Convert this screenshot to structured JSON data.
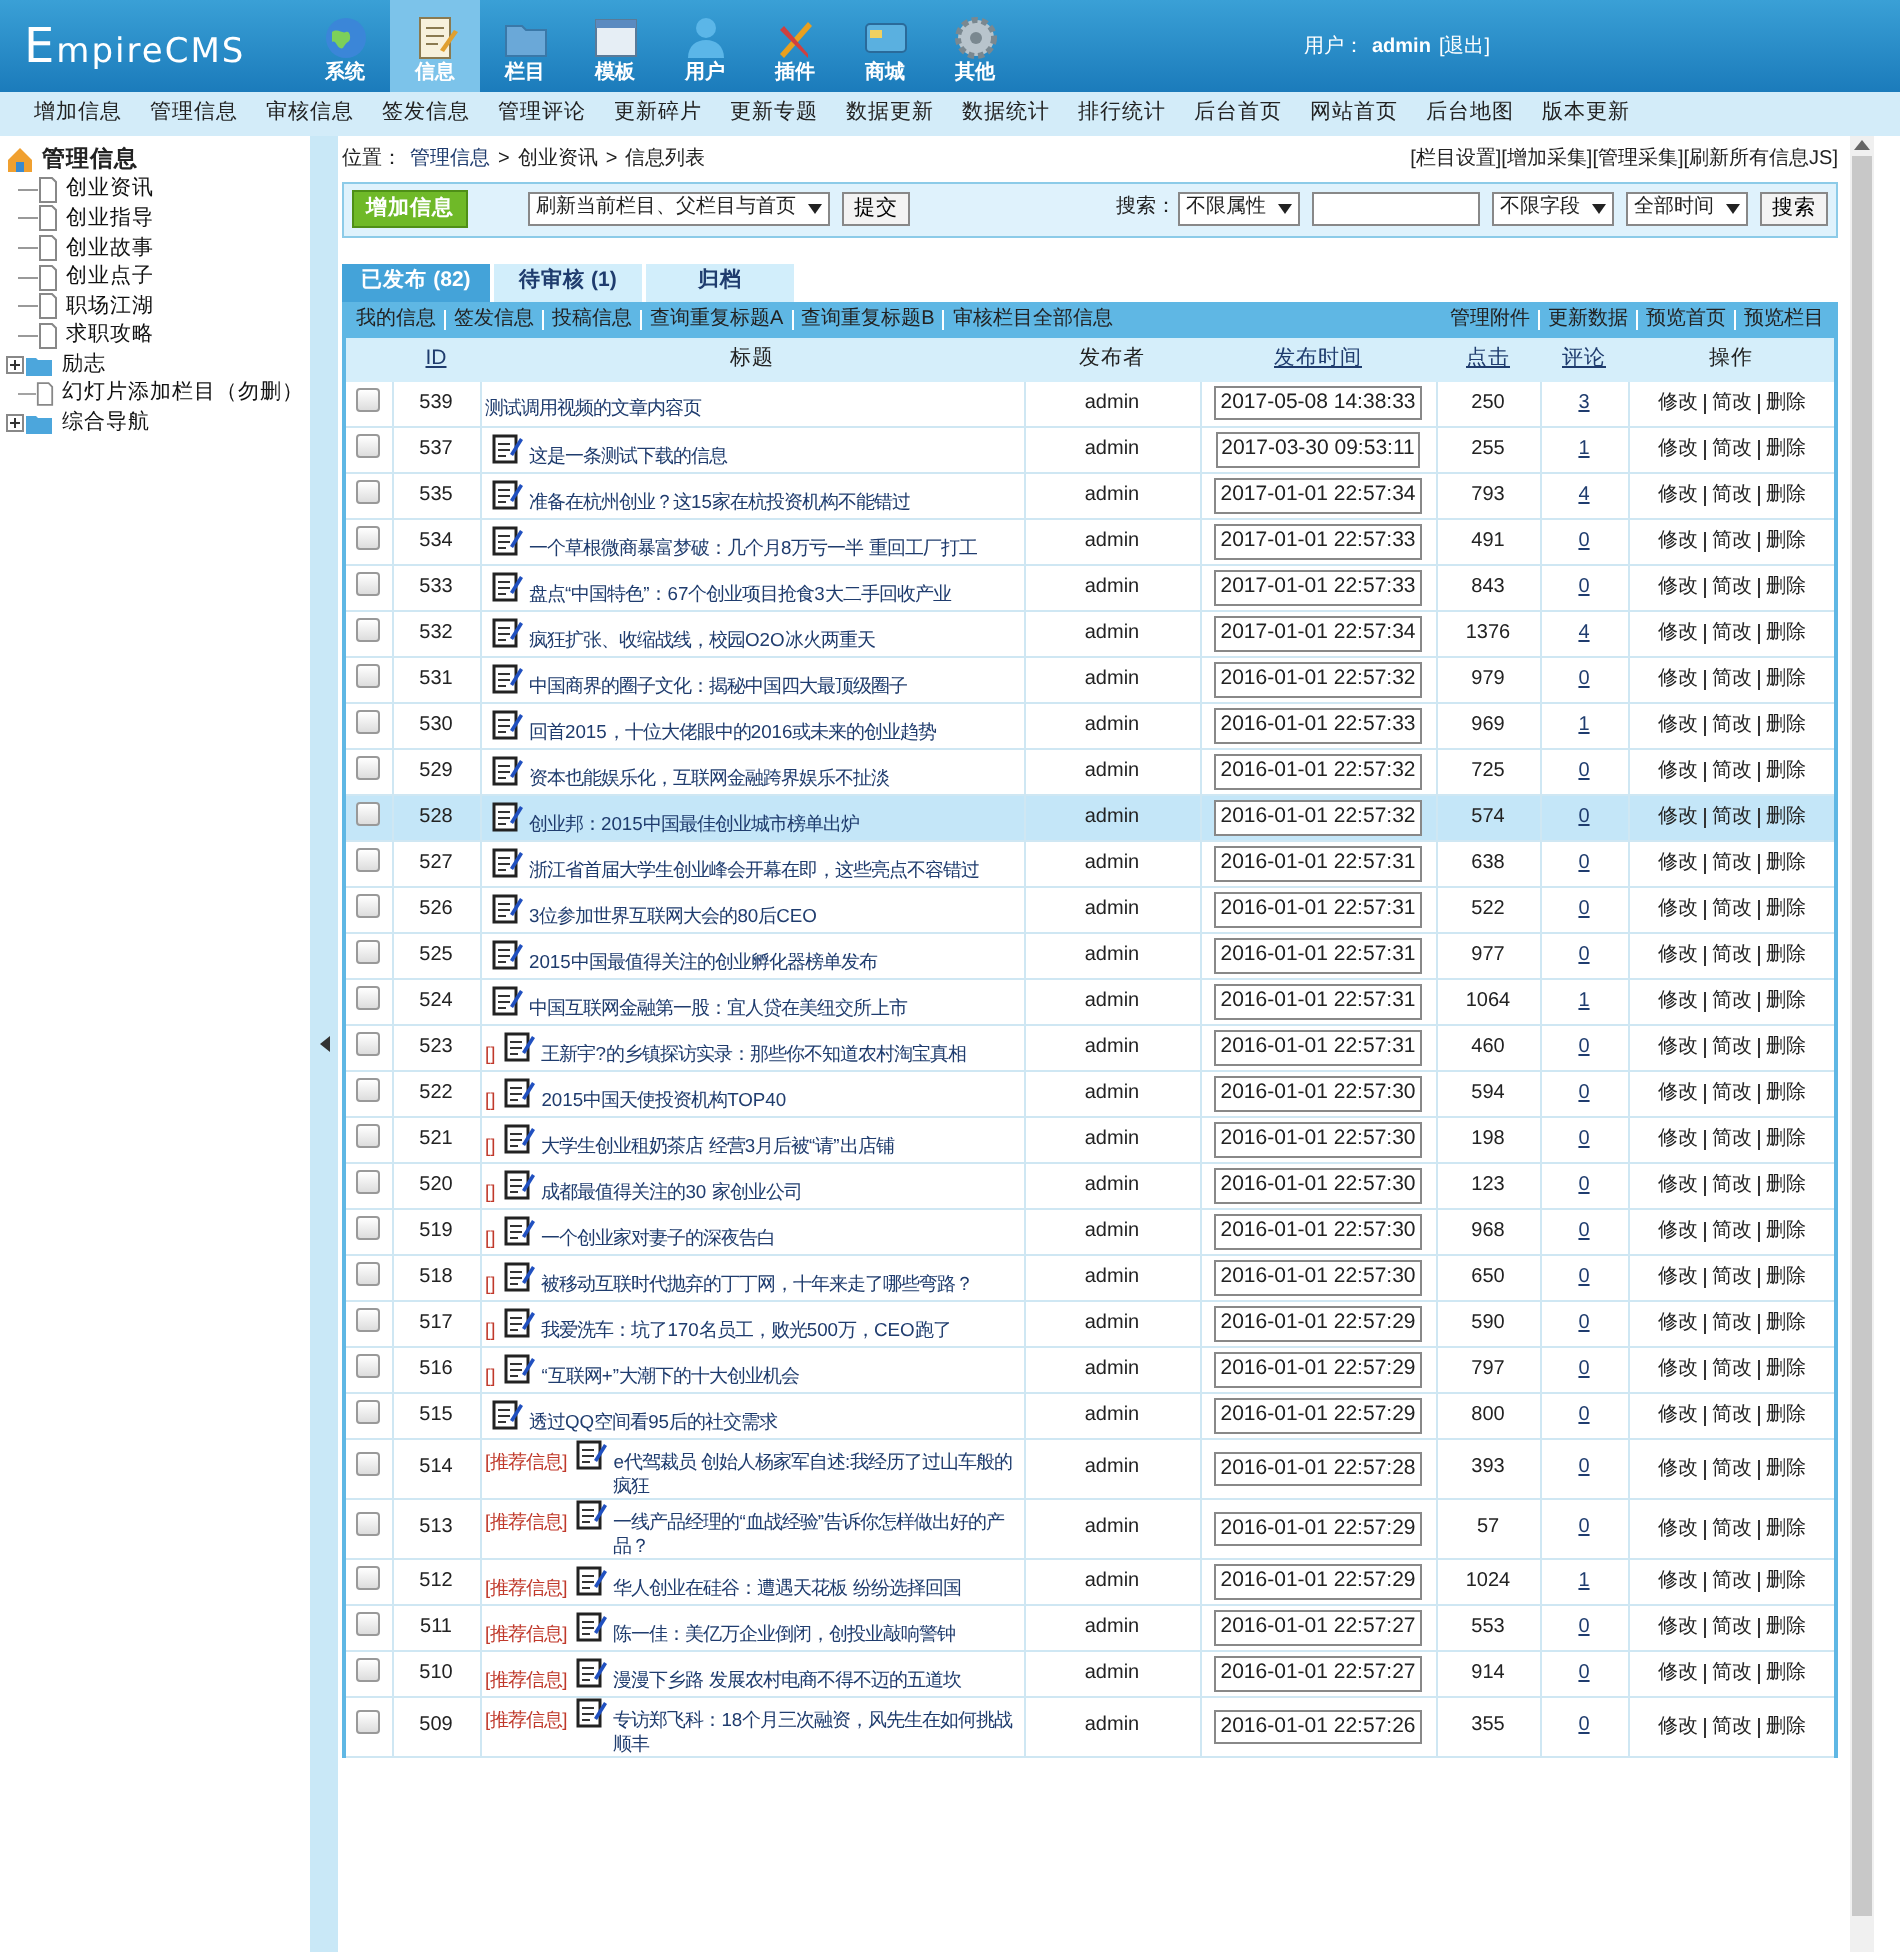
{
  "logo": "EmpireCMS",
  "top_tabs": [
    {
      "label": "系统",
      "selected": false
    },
    {
      "label": "信息",
      "selected": true
    },
    {
      "label": "栏目",
      "selected": false
    },
    {
      "label": "模板",
      "selected": false
    },
    {
      "label": "用户",
      "selected": false
    },
    {
      "label": "插件",
      "selected": false
    },
    {
      "label": "商城",
      "selected": false
    },
    {
      "label": "其他",
      "selected": false
    }
  ],
  "user": {
    "label": "用户：",
    "name": "admin",
    "logout": "[退出]"
  },
  "menu": [
    "增加信息",
    "管理信息",
    "审核信息",
    "签发信息",
    "管理评论",
    "更新碎片",
    "更新专题",
    "数据更新",
    "数据统计",
    "排行统计",
    "后台首页",
    "网站首页",
    "后台地图",
    "版本更新"
  ],
  "tree": {
    "label": "管理信息",
    "children": [
      {
        "label": "创业资讯",
        "kind": "leaf"
      },
      {
        "label": "创业指导",
        "kind": "leaf"
      },
      {
        "label": "创业故事",
        "kind": "leaf"
      },
      {
        "label": "创业点子",
        "kind": "leaf"
      },
      {
        "label": "职场江湖",
        "kind": "leaf"
      },
      {
        "label": "求职攻略",
        "kind": "leaf"
      },
      {
        "label": "励志",
        "kind": "folder",
        "expanded": false
      },
      {
        "label": "幻灯片添加栏目（勿删）",
        "kind": "leaf"
      },
      {
        "label": "综合导航",
        "kind": "folder",
        "expanded": false
      }
    ]
  },
  "location": {
    "label": "位置：",
    "crumbs": [
      "管理信息",
      "创业资讯",
      "信息列表"
    ],
    "separator": ">"
  },
  "top_links": [
    "[栏目设置]",
    "[增加采集]",
    "[管理采集]",
    "[刷新所有信息JS]"
  ],
  "toolbar": {
    "add_button": "增加信息",
    "refresh_select": "刷新当前栏目、父栏目与首页",
    "submit": "提交",
    "search_label": "搜索：",
    "attr_select": "不限属性",
    "field_select": "不限字段",
    "time_select": "全部时间",
    "search_button": "搜索"
  },
  "tabs": [
    {
      "label": "已发布 (82)",
      "selected": true
    },
    {
      "label": "待审核 (1)",
      "selected": false
    },
    {
      "label": "归档",
      "selected": false
    }
  ],
  "links_left": [
    "我的信息",
    "签发信息",
    "投稿信息",
    "查询重复标题A",
    "查询重复标题B",
    "审核栏目全部信息"
  ],
  "links_right": [
    "管理附件",
    "更新数据",
    "预览首页",
    "预览栏目"
  ],
  "columns": [
    {
      "label": "ID",
      "link": true
    },
    {
      "label": "标题",
      "link": false
    },
    {
      "label": "发布者",
      "link": false
    },
    {
      "label": "发布时间",
      "link": true
    },
    {
      "label": "点击",
      "link": true
    },
    {
      "label": "评论",
      "link": true
    },
    {
      "label": "操作",
      "link": false
    }
  ],
  "rows": [
    {
      "checked": false,
      "selected": false,
      "id": "539",
      "icon": false,
      "title": "测试调用视频的文章内容页",
      "author": "admin",
      "time": "2017-05-08 14:38:33",
      "clicks": "250",
      "comments": "3",
      "actions": [
        "修改",
        "简改",
        "删除"
      ]
    },
    {
      "checked": false,
      "selected": false,
      "id": "537",
      "icon": true,
      "title": "这是一条测试下载的信息",
      "author": "admin",
      "time": "2017-03-30 09:53:11",
      "clicks": "255",
      "comments": "1",
      "actions": [
        "修改",
        "简改",
        "删除"
      ]
    },
    {
      "checked": false,
      "selected": false,
      "id": "535",
      "icon": true,
      "title": "准备在杭州创业？这15家在杭投资机构不能错过",
      "author": "admin",
      "time": "2017-01-01 22:57:34",
      "clicks": "793",
      "comments": "4",
      "actions": [
        "修改",
        "简改",
        "删除"
      ]
    },
    {
      "checked": false,
      "selected": false,
      "id": "534",
      "icon": true,
      "title": "一个草根微商暴富梦破：几个月8万亏一半 重回工厂打工",
      "author": "admin",
      "time": "2017-01-01 22:57:33",
      "clicks": "491",
      "comments": "0",
      "actions": [
        "修改",
        "简改",
        "删除"
      ]
    },
    {
      "checked": false,
      "selected": false,
      "id": "533",
      "icon": true,
      "title": "盘点“中国特色”：67个创业项目抢食3大二手回收产业",
      "author": "admin",
      "time": "2017-01-01 22:57:33",
      "clicks": "843",
      "comments": "0",
      "actions": [
        "修改",
        "简改",
        "删除"
      ]
    },
    {
      "checked": false,
      "selected": false,
      "id": "532",
      "icon": true,
      "title": "疯狂扩张、收缩战线，校园O2O冰火两重天",
      "author": "admin",
      "time": "2017-01-01 22:57:34",
      "clicks": "1376",
      "comments": "4",
      "actions": [
        "修改",
        "简改",
        "删除"
      ]
    },
    {
      "checked": false,
      "selected": false,
      "id": "531",
      "icon": true,
      "title": "中国商界的圈子文化：揭秘中国四大最顶级圈子",
      "author": "admin",
      "time": "2016-01-01 22:57:32",
      "clicks": "979",
      "comments": "0",
      "actions": [
        "修改",
        "简改",
        "删除"
      ]
    },
    {
      "checked": false,
      "selected": false,
      "id": "530",
      "icon": true,
      "title": "回首2015，十位大佬眼中的2016或未来的创业趋势",
      "author": "admin",
      "time": "2016-01-01 22:57:33",
      "clicks": "969",
      "comments": "1",
      "actions": [
        "修改",
        "简改",
        "删除"
      ]
    },
    {
      "checked": false,
      "selected": false,
      "id": "529",
      "icon": true,
      "title": "资本也能娱乐化，互联网金融跨界娱乐不扯淡",
      "author": "admin",
      "time": "2016-01-01 22:57:32",
      "clicks": "725",
      "comments": "0",
      "actions": [
        "修改",
        "简改",
        "删除"
      ]
    },
    {
      "checked": false,
      "selected": true,
      "id": "528",
      "icon": true,
      "title": "创业邦：2015中国最佳创业城市榜单出炉",
      "author": "admin",
      "time": "2016-01-01 22:57:32",
      "clicks": "574",
      "comments": "0",
      "actions": [
        "修改",
        "简改",
        "删除"
      ]
    },
    {
      "checked": false,
      "selected": false,
      "id": "527",
      "icon": true,
      "title": "浙江省首届大学生创业峰会开幕在即，这些亮点不容错过",
      "author": "admin",
      "time": "2016-01-01 22:57:31",
      "clicks": "638",
      "comments": "0",
      "actions": [
        "修改",
        "简改",
        "删除"
      ]
    },
    {
      "checked": false,
      "selected": false,
      "id": "526",
      "icon": true,
      "title": "3位参加世界互联网大会的80后CEO",
      "author": "admin",
      "time": "2016-01-01 22:57:31",
      "clicks": "522",
      "comments": "0",
      "actions": [
        "修改",
        "简改",
        "删除"
      ]
    },
    {
      "checked": false,
      "selected": false,
      "id": "525",
      "icon": true,
      "title": "2015中国最值得关注的创业孵化器榜单发布",
      "author": "admin",
      "time": "2016-01-01 22:57:31",
      "clicks": "977",
      "comments": "0",
      "actions": [
        "修改",
        "简改",
        "删除"
      ]
    },
    {
      "checked": false,
      "selected": false,
      "id": "524",
      "icon": true,
      "title": "中国互联网金融第一股：宜人贷在美纽交所上市",
      "author": "admin",
      "time": "2016-01-01 22:57:31",
      "clicks": "1064",
      "comments": "1",
      "actions": [
        "修改",
        "简改",
        "删除"
      ]
    },
    {
      "checked": false,
      "selected": false,
      "id": "523",
      "tag": "[]",
      "icon": true,
      "title": "王新宇?的乡镇探访实录：那些你不知道农村淘宝真相",
      "author": "admin",
      "time": "2016-01-01 22:57:31",
      "clicks": "460",
      "comments": "0",
      "actions": [
        "修改",
        "简改",
        "删除"
      ]
    },
    {
      "checked": false,
      "selected": false,
      "id": "522",
      "tag": "[]",
      "icon": true,
      "title": "2015中国天使投资机构TOP40",
      "author": "admin",
      "time": "2016-01-01 22:57:30",
      "clicks": "594",
      "comments": "0",
      "actions": [
        "修改",
        "简改",
        "删除"
      ]
    },
    {
      "checked": false,
      "selected": false,
      "id": "521",
      "tag": "[]",
      "icon": true,
      "title": "大学生创业租奶茶店 经营3月后被“请”出店铺",
      "author": "admin",
      "time": "2016-01-01 22:57:30",
      "clicks": "198",
      "comments": "0",
      "actions": [
        "修改",
        "简改",
        "删除"
      ]
    },
    {
      "checked": false,
      "selected": false,
      "id": "520",
      "tag": "[]",
      "icon": true,
      "title": "成都最值得关注的30 家创业公司",
      "author": "admin",
      "time": "2016-01-01 22:57:30",
      "clicks": "123",
      "comments": "0",
      "actions": [
        "修改",
        "简改",
        "删除"
      ]
    },
    {
      "checked": false,
      "selected": false,
      "id": "519",
      "tag": "[]",
      "icon": true,
      "title": "一个创业家对妻子的深夜告白",
      "author": "admin",
      "time": "2016-01-01 22:57:30",
      "clicks": "968",
      "comments": "0",
      "actions": [
        "修改",
        "简改",
        "删除"
      ]
    },
    {
      "checked": false,
      "selected": false,
      "id": "518",
      "tag": "[]",
      "icon": true,
      "title": "被移动互联时代抛弃的丁丁网，十年来走了哪些弯路？",
      "author": "admin",
      "time": "2016-01-01 22:57:30",
      "clicks": "650",
      "comments": "0",
      "actions": [
        "修改",
        "简改",
        "删除"
      ]
    },
    {
      "checked": false,
      "selected": false,
      "id": "517",
      "tag": "[]",
      "icon": true,
      "title": "我爱洗车：坑了170名员工，败光500万，CEO跑了",
      "author": "admin",
      "time": "2016-01-01 22:57:29",
      "clicks": "590",
      "comments": "0",
      "actions": [
        "修改",
        "简改",
        "删除"
      ]
    },
    {
      "checked": false,
      "selected": false,
      "id": "516",
      "tag": "[]",
      "icon": true,
      "title": "“互联网+”大潮下的十大创业机会",
      "author": "admin",
      "time": "2016-01-01 22:57:29",
      "clicks": "797",
      "comments": "0",
      "actions": [
        "修改",
        "简改",
        "删除"
      ]
    },
    {
      "checked": false,
      "selected": false,
      "id": "515",
      "icon": true,
      "title": "透过QQ空间看95后的社交需求",
      "author": "admin",
      "time": "2016-01-01 22:57:29",
      "clicks": "800",
      "comments": "0",
      "actions": [
        "修改",
        "简改",
        "删除"
      ]
    },
    {
      "checked": false,
      "selected": false,
      "id": "514",
      "tag": "[推荐信息]",
      "icon": true,
      "title": "e代驾裁员 创始人杨家军自述:我经历了过山车般的疯狂",
      "author": "admin",
      "time": "2016-01-01 22:57:28",
      "clicks": "393",
      "comments": "0",
      "actions": [
        "修改",
        "简改",
        "删除"
      ]
    },
    {
      "checked": false,
      "selected": false,
      "id": "513",
      "tag": "[推荐信息]",
      "icon": true,
      "title": "一线产品经理的“血战经验”告诉你怎样做出好的产品？",
      "author": "admin",
      "time": "2016-01-01 22:57:29",
      "clicks": "57",
      "comments": "0",
      "actions": [
        "修改",
        "简改",
        "删除"
      ]
    },
    {
      "checked": false,
      "selected": false,
      "id": "512",
      "tag": "[推荐信息]",
      "icon": true,
      "title": "华人创业在硅谷：遭遇天花板 纷纷选择回国",
      "author": "admin",
      "time": "2016-01-01 22:57:29",
      "clicks": "1024",
      "comments": "1",
      "actions": [
        "修改",
        "简改",
        "删除"
      ]
    },
    {
      "checked": false,
      "selected": false,
      "id": "511",
      "tag": "[推荐信息]",
      "icon": true,
      "title": "陈一佳：美亿万企业倒闭，创投业敲响警钟",
      "author": "admin",
      "time": "2016-01-01 22:57:27",
      "clicks": "553",
      "comments": "0",
      "actions": [
        "修改",
        "简改",
        "删除"
      ]
    },
    {
      "checked": false,
      "selected": false,
      "id": "510",
      "tag": "[推荐信息]",
      "icon": true,
      "title": "漫漫下乡路 发展农村电商不得不迈的五道坎",
      "author": "admin",
      "time": "2016-01-01 22:57:27",
      "clicks": "914",
      "comments": "0",
      "actions": [
        "修改",
        "简改",
        "删除"
      ]
    },
    {
      "checked": false,
      "selected": false,
      "id": "509",
      "tag": "[推荐信息]",
      "icon": true,
      "title": "专访郑飞科：18个月三次融资，风先生在如何挑战顺丰",
      "author": "admin",
      "time": "2016-01-01 22:57:26",
      "clicks": "355",
      "comments": "0",
      "actions": [
        "修改",
        "简改",
        "删除"
      ]
    }
  ]
}
